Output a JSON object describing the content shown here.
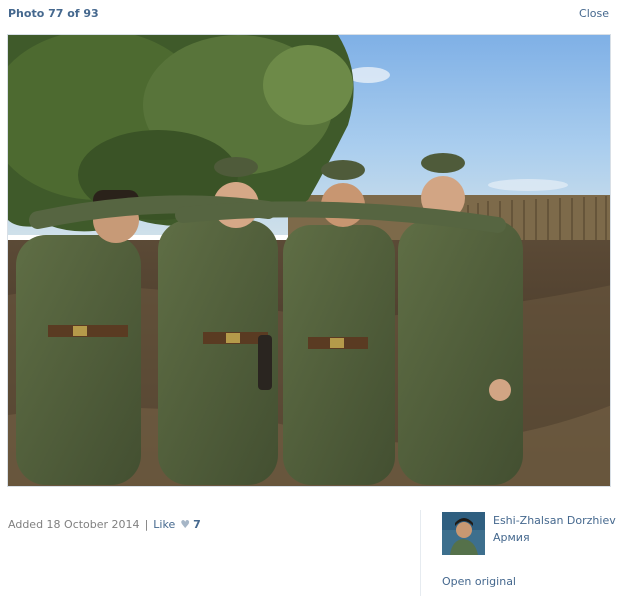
{
  "header": {
    "counter": "Photo 77 of 93",
    "close_label": "Close"
  },
  "photo": {
    "description": "photo-content"
  },
  "info": {
    "added_text": "Added 18 October 2014",
    "separator": "|",
    "like_label": "Like",
    "like_count": "7",
    "author_name": "Eshi-Zhalsan Dorzhiev",
    "album_name": "Армия",
    "open_original_label": "Open original"
  },
  "colors": {
    "link": "#45688e",
    "muted": "#808080",
    "heart": "#a6b6c7"
  },
  "icons": {
    "heart": "heart-icon"
  }
}
